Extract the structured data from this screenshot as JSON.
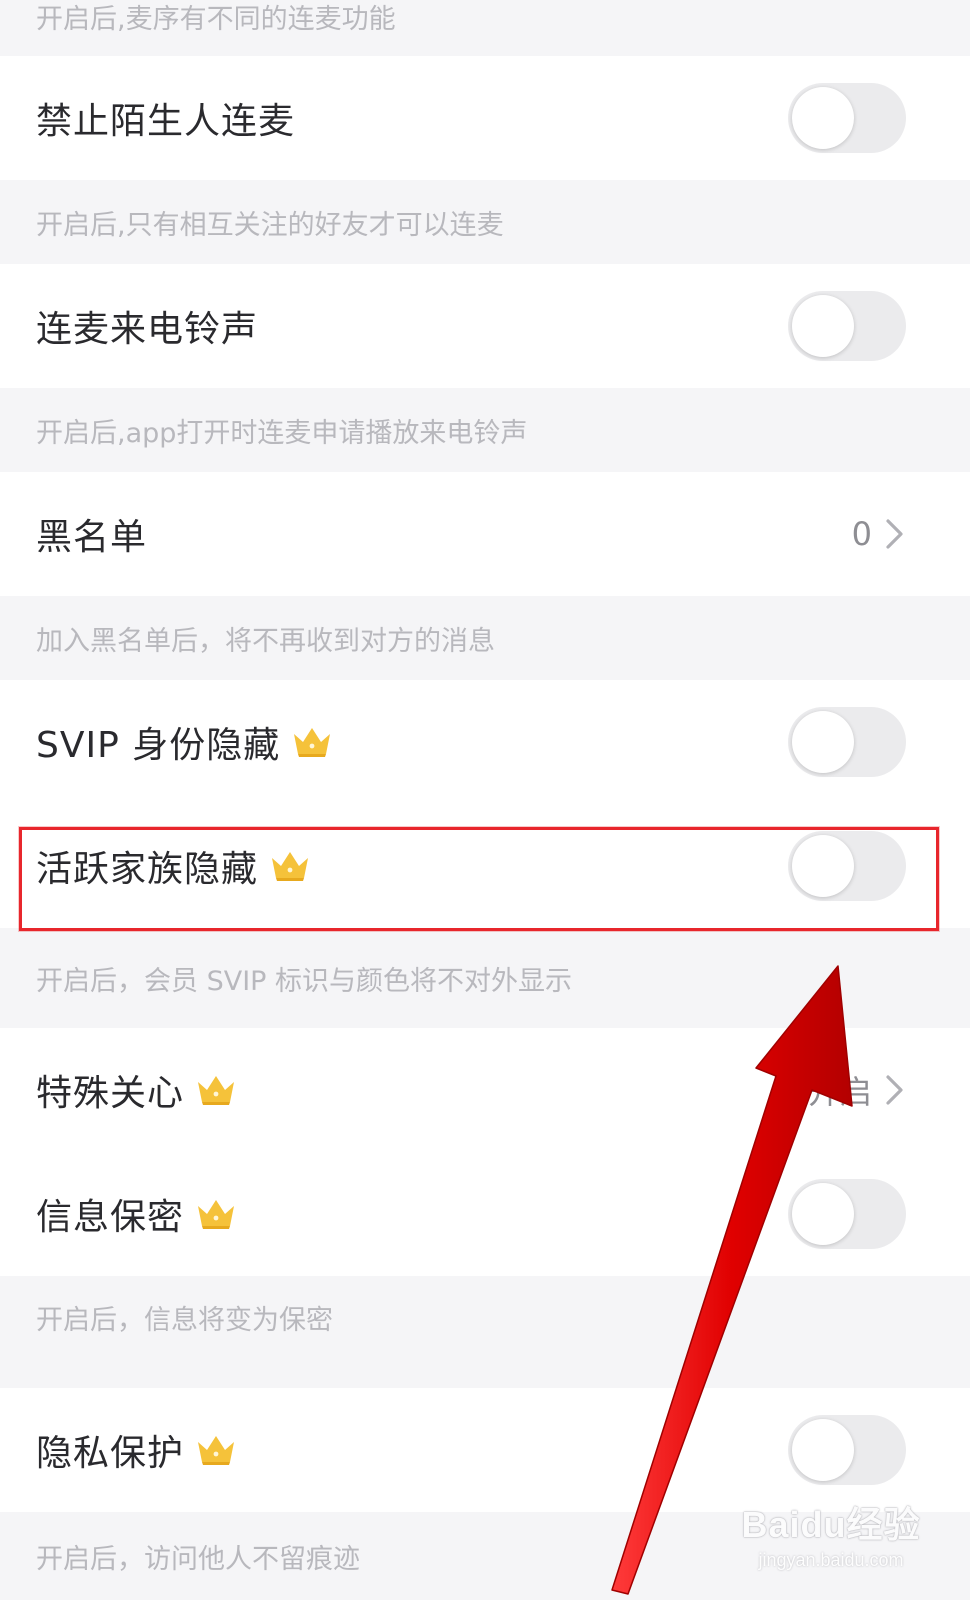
{
  "top_note": "开启后,麦序有不同的连麦功能",
  "rows": [
    {
      "label": "禁止陌生人连麦",
      "control": "toggle",
      "on": false
    },
    {
      "label": "连麦来电铃声",
      "control": "toggle",
      "on": false
    },
    {
      "label": "黑名单",
      "control": "value",
      "value": "0"
    },
    {
      "label": "SVIP 身份隐藏",
      "control": "toggle",
      "on": false,
      "crown": true
    },
    {
      "label": "活跃家族隐藏",
      "control": "toggle",
      "on": false,
      "crown": true
    },
    {
      "label": "特殊关心",
      "control": "value",
      "value": "未开启",
      "crown": true
    },
    {
      "label": "信息保密",
      "control": "toggle",
      "on": false,
      "crown": true
    },
    {
      "label": "隐私保护",
      "control": "toggle",
      "on": false,
      "crown": true
    }
  ],
  "notes": [
    "开启后,只有相互关注的好友才可以连麦",
    "开启后,app打开时连麦申请播放来电铃声",
    "加入黑名单后，将不再收到对方的消息",
    "开启后，会员 SVIP 标识与颜色将不对外显示",
    "开启后，信息将变为保密",
    "开启后，访问他人不留痕迹"
  ],
  "watermark": {
    "main": "Baidu经验",
    "sub": "jingyan.baidu.com"
  },
  "colors": {
    "highlight": "#e8262c",
    "arrow": "#ff1a1a",
    "crown": "#f5c23a",
    "toggle_off": "#ebebed"
  }
}
